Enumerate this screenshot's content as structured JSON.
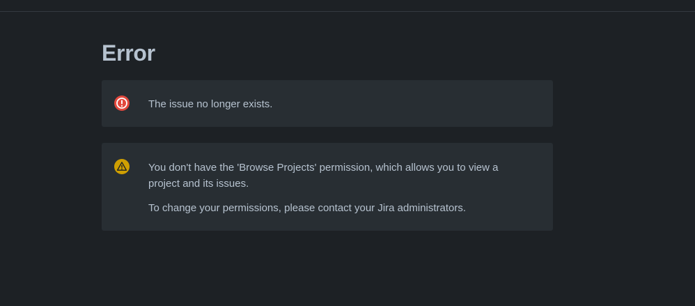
{
  "page": {
    "title": "Error"
  },
  "messages": [
    {
      "type": "error",
      "icon": "error-icon",
      "color": "#e2483d",
      "lines": [
        "The issue no longer exists."
      ]
    },
    {
      "type": "warning",
      "icon": "warning-icon",
      "color": "#cf9f02",
      "lines": [
        "You don't have the 'Browse Projects' permission, which allows you to view a project and its issues.",
        "To change your permissions, please contact your Jira administrators."
      ]
    }
  ]
}
